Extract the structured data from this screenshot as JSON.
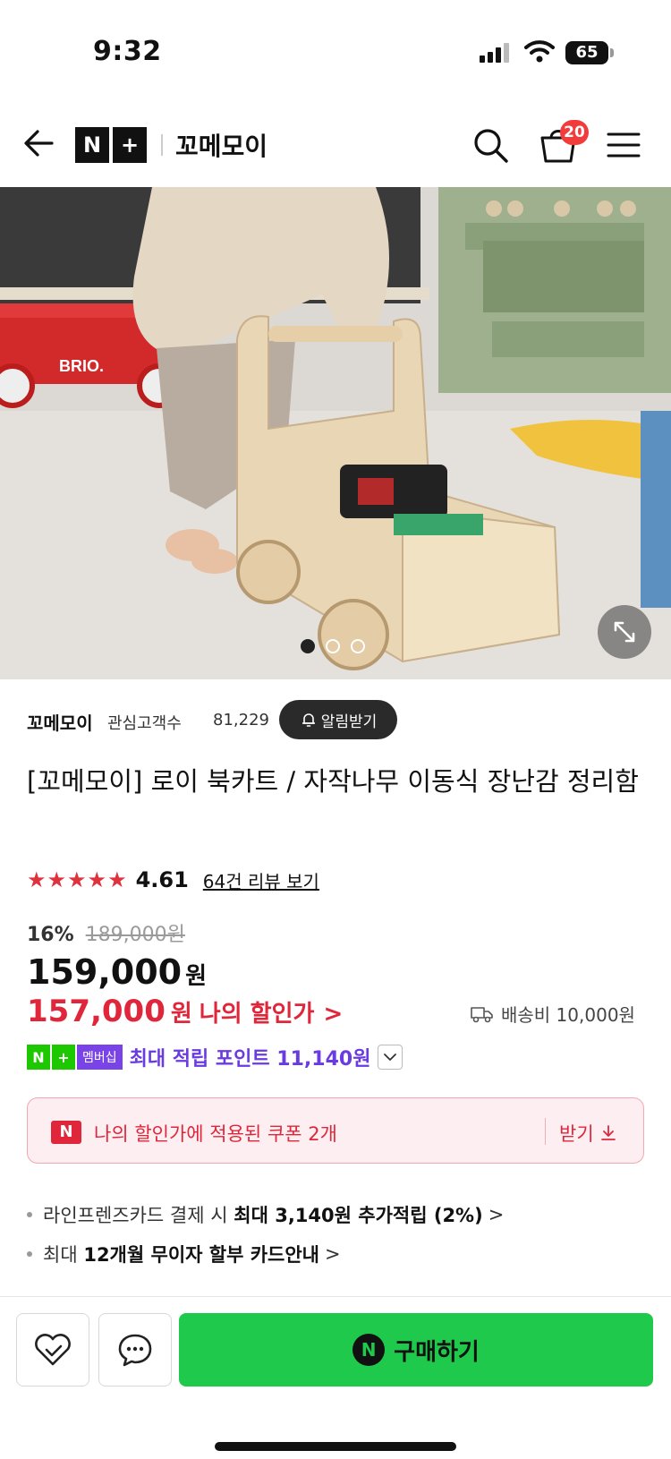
{
  "status": {
    "time": "9:32",
    "battery": "65"
  },
  "header": {
    "nplus_n": "N",
    "nplus_plus": "+",
    "store_name": "꼬메모이",
    "cart_count": "20"
  },
  "gallery": {
    "image_count": 3,
    "active_index": 0
  },
  "seller": {
    "name": "꼬메모이",
    "fan_label": "관심고객수",
    "fan_count": "81,229",
    "alarm_label": "알림받기"
  },
  "product": {
    "title": "[꼬메모이] 로이 북카트 / 자작나무 이동식 장난감 정리함",
    "rating": "4.61",
    "rating_value": 4.61,
    "review_link": "64건 리뷰 보기",
    "discount_pct": "16%",
    "original_price": "189,000원",
    "price": "159,000",
    "price_unit": "원",
    "my_price": "157,000",
    "my_price_unit": "원",
    "my_price_label": "나의 할인가",
    "my_price_chevron": ">",
    "shipping": "배송비 10,000원"
  },
  "membership": {
    "badge_n": "N",
    "badge_plus": "+",
    "badge_label": "멤버십",
    "text": "최대 적립 포인트 11,140원"
  },
  "coupon": {
    "icon_letter": "N",
    "text": "나의 할인가에 적용된 쿠폰 2개",
    "action": "받기"
  },
  "benefits": [
    {
      "prefix": "라인프렌즈카드 결제 시 ",
      "bold": "최대 3,140원 추가적립 (2%)",
      "chevron": ">"
    },
    {
      "prefix": "최대 ",
      "bold": "12개월 무이자 할부 카드안내",
      "chevron": ">"
    }
  ],
  "bottom": {
    "buy_icon_letter": "N",
    "buy_label": "구매하기"
  },
  "colors": {
    "accent_red": "#e0263a",
    "buy_green": "#1ec94b",
    "member_purple": "#6a3be0",
    "star_red": "#e0323c"
  }
}
